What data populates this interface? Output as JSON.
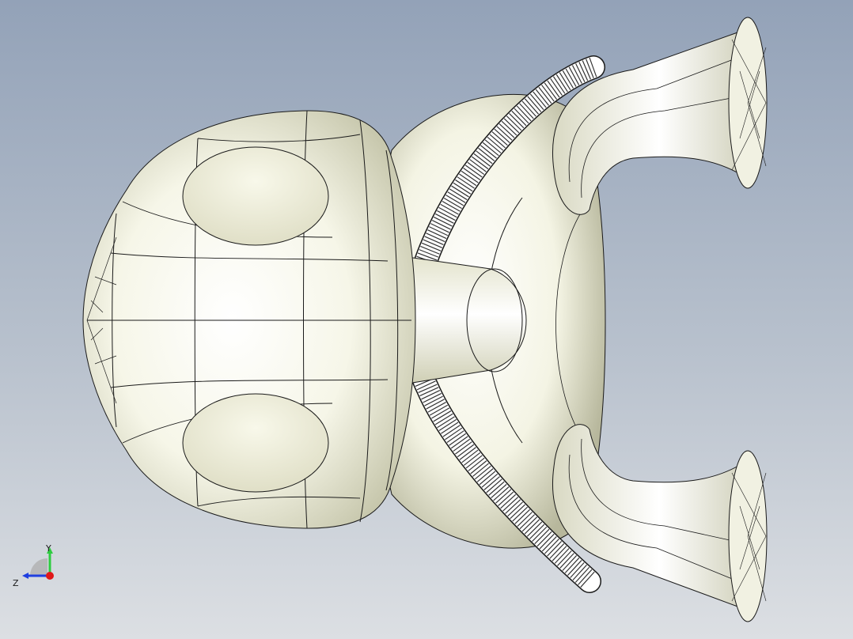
{
  "viewport": {
    "background_top": "#93a2b8",
    "background_bottom": "#dcdfe3",
    "model_face_color": "#f4f4e6",
    "edge_color": "#1a1a1a"
  },
  "triad": {
    "y_label": "Y",
    "z_label": "Z",
    "y_axis_color": "#2ecc40",
    "z_axis_color": "#1f3fe0",
    "x_axis_color": "#e01818"
  }
}
